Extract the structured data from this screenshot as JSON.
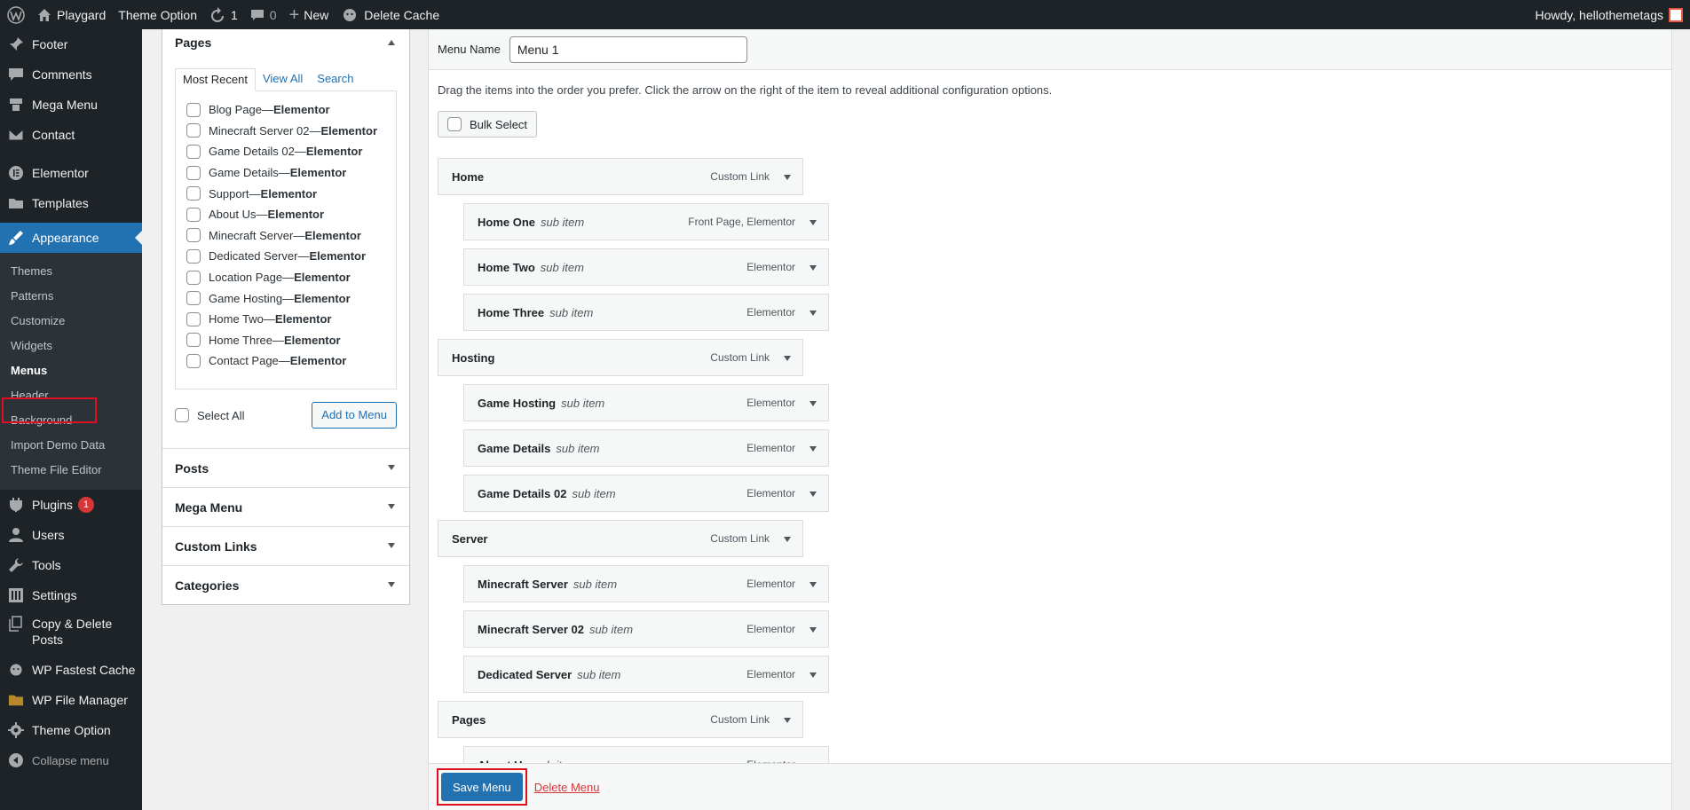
{
  "adminbar": {
    "site_name": "Playgard",
    "theme_option": "Theme Option",
    "updates_count": "1",
    "comments_count": "0",
    "new_label": "New",
    "delete_cache": "Delete Cache",
    "howdy": "Howdy, hellothemetags"
  },
  "sidebar": {
    "top_items": [
      {
        "label": "Footer",
        "icon": "pin-icon"
      },
      {
        "label": "Comments",
        "icon": "comment-icon"
      },
      {
        "label": "Mega Menu",
        "icon": "megamenu-icon"
      },
      {
        "label": "Contact",
        "icon": "mail-icon"
      },
      {
        "label": "Elementor",
        "icon": "elementor-icon"
      },
      {
        "label": "Templates",
        "icon": "folder-icon"
      }
    ],
    "current": {
      "label": "Appearance",
      "icon": "paintbrush-icon"
    },
    "submenu": [
      "Themes",
      "Patterns",
      "Customize",
      "Widgets",
      "Menus",
      "Header",
      "Background",
      "Import Demo Data",
      "Theme File Editor"
    ],
    "active_sub": "Menus",
    "bottom_items": [
      {
        "label": "Plugins",
        "badge": "1"
      },
      {
        "label": "Users"
      },
      {
        "label": "Tools"
      },
      {
        "label": "Settings"
      },
      {
        "label": "Copy & Delete Posts"
      },
      {
        "label": "WP Fastest Cache"
      },
      {
        "label": "WP File Manager"
      },
      {
        "label": "Theme Option"
      },
      {
        "label": "Collapse menu"
      }
    ]
  },
  "accordion": {
    "pages_title": "Pages",
    "tabs": [
      "Most Recent",
      "View All",
      "Search"
    ],
    "pages": [
      {
        "name": "Blog Page",
        "builder": "Elementor"
      },
      {
        "name": "Minecraft Server 02",
        "builder": "Elementor"
      },
      {
        "name": "Game Details 02",
        "builder": "Elementor"
      },
      {
        "name": "Game Details",
        "builder": "Elementor"
      },
      {
        "name": "Support",
        "builder": "Elementor"
      },
      {
        "name": "About Us",
        "builder": "Elementor"
      },
      {
        "name": "Minecraft Server",
        "builder": "Elementor"
      },
      {
        "name": "Dedicated Server",
        "builder": "Elementor"
      },
      {
        "name": "Location Page",
        "builder": "Elementor"
      },
      {
        "name": "Game Hosting",
        "builder": "Elementor"
      },
      {
        "name": "Home Two",
        "builder": "Elementor"
      },
      {
        "name": "Home Three",
        "builder": "Elementor"
      },
      {
        "name": "Contact Page",
        "builder": "Elementor"
      }
    ],
    "separator": " — ",
    "select_all": "Select All",
    "add_to_menu": "Add to Menu",
    "sections": [
      "Posts",
      "Mega Menu",
      "Custom Links",
      "Categories"
    ]
  },
  "menu": {
    "name_label": "Menu Name",
    "name_value": "Menu 1",
    "instructions": "Drag the items into the order you prefer. Click the arrow on the right of the item to reveal additional configuration options.",
    "bulk_select": "Bulk Select",
    "sub_item_label": "sub item",
    "items": [
      {
        "title": "Home",
        "type": "Custom Link",
        "depth": 0
      },
      {
        "title": "Home One",
        "type": "Front Page, Elementor",
        "depth": 1
      },
      {
        "title": "Home Two",
        "type": "Elementor",
        "depth": 1
      },
      {
        "title": "Home Three",
        "type": "Elementor",
        "depth": 1
      },
      {
        "title": "Hosting",
        "type": "Custom Link",
        "depth": 0
      },
      {
        "title": "Game Hosting",
        "type": "Elementor",
        "depth": 1
      },
      {
        "title": "Game Details",
        "type": "Elementor",
        "depth": 1
      },
      {
        "title": "Game Details 02",
        "type": "Elementor",
        "depth": 1
      },
      {
        "title": "Server",
        "type": "Custom Link",
        "depth": 0
      },
      {
        "title": "Minecraft Server",
        "type": "Elementor",
        "depth": 1
      },
      {
        "title": "Minecraft Server 02",
        "type": "Elementor",
        "depth": 1
      },
      {
        "title": "Dedicated Server",
        "type": "Elementor",
        "depth": 1
      },
      {
        "title": "Pages",
        "type": "Custom Link",
        "depth": 0
      },
      {
        "title": "About Us",
        "type": "Elementor",
        "depth": 1
      }
    ],
    "save_label": "Save Menu",
    "delete_label": "Delete Menu"
  }
}
